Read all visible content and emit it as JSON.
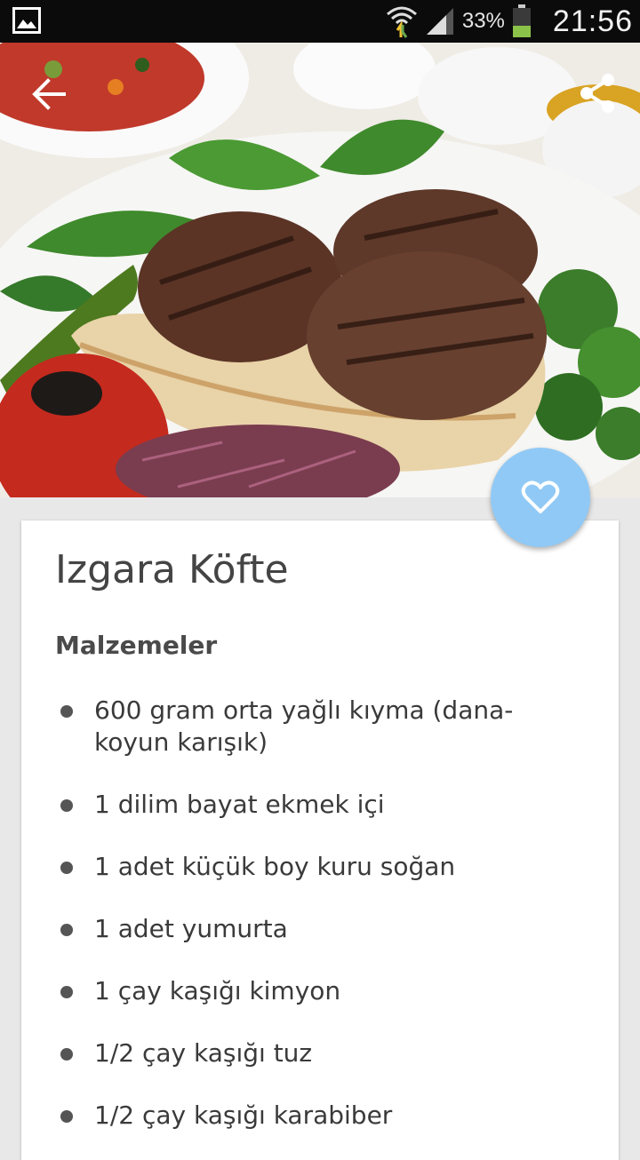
{
  "status_bar": {
    "battery_percent": "33%",
    "time": "21:56"
  },
  "hero": {
    "image": "grilled-meatballs-photo"
  },
  "recipe": {
    "title": "Izgara Köfte",
    "ingredients_heading": "Malzemeler",
    "ingredients": [
      "600 gram orta yağlı kıyma (dana-koyun karışık)",
      "1 dilim bayat ekmek içi",
      "1 adet küçük boy kuru soğan",
      "1 adet yumurta",
      "1 çay kaşığı kimyon",
      "1/2 çay kaşığı tuz",
      "1/2 çay kaşığı karabiber"
    ]
  },
  "colors": {
    "fab": "#90c9f5",
    "status_bar": "#0b0b0b"
  }
}
